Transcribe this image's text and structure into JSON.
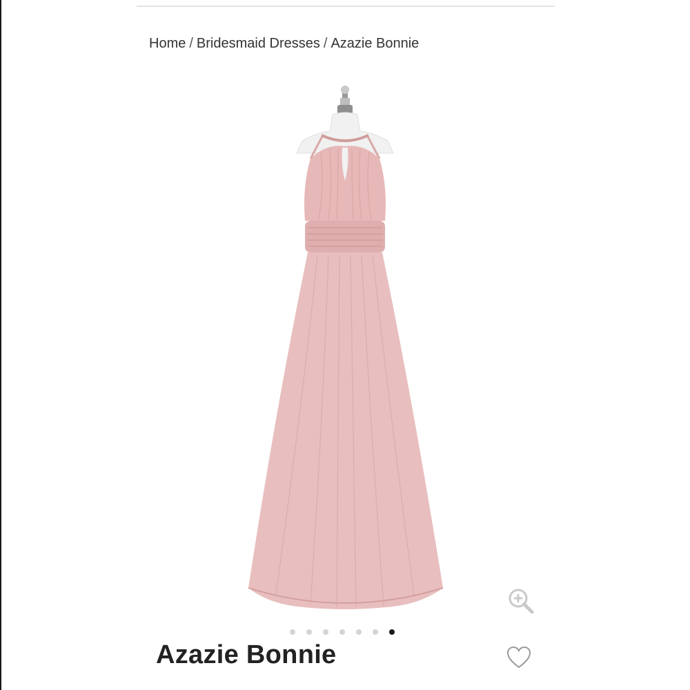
{
  "breadcrumb": {
    "items": [
      "Home",
      "Bridesmaid Dresses",
      "Azazie Bonnie"
    ],
    "separator": "/"
  },
  "product": {
    "title": "Azazie Bonnie",
    "image_alt_icon": "dress-image",
    "dress_color": "#e8bfbe"
  },
  "gallery": {
    "total_images": 7,
    "active_index": 7
  },
  "icons": {
    "zoom": "zoom-in-icon",
    "wishlist": "heart-outline-icon"
  }
}
